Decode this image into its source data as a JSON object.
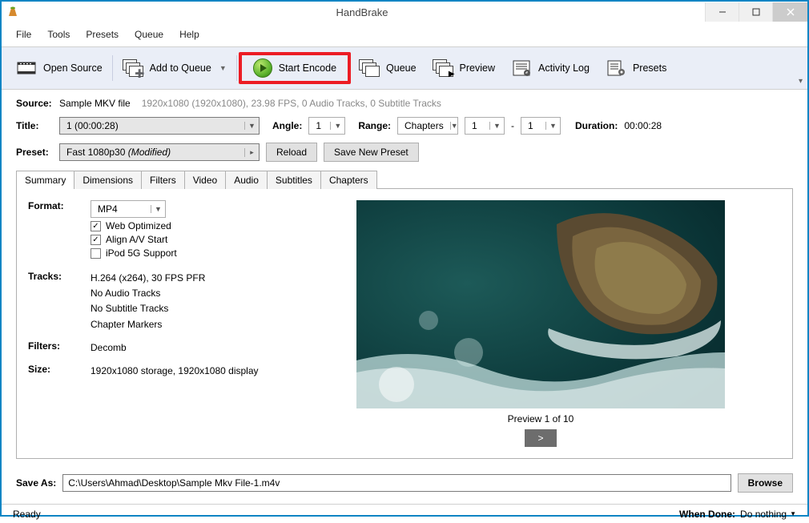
{
  "title": "HandBrake",
  "menubar": [
    "File",
    "Tools",
    "Presets",
    "Queue",
    "Help"
  ],
  "toolbar": {
    "open_source": "Open Source",
    "add_to_queue": "Add to Queue",
    "start_encode": "Start Encode",
    "queue": "Queue",
    "preview": "Preview",
    "activity_log": "Activity Log",
    "presets": "Presets"
  },
  "source": {
    "label": "Source:",
    "name": "Sample MKV file",
    "info": "1920x1080 (1920x1080), 23.98 FPS, 0 Audio Tracks, 0 Subtitle Tracks"
  },
  "title_row": {
    "label": "Title:",
    "value": "1 (00:00:28)",
    "angle_label": "Angle:",
    "angle_value": "1",
    "range_label": "Range:",
    "range_type": "Chapters",
    "range_from": "1",
    "range_dash": "-",
    "range_to": "1",
    "duration_label": "Duration:",
    "duration_value": "00:00:28"
  },
  "preset_row": {
    "label": "Preset:",
    "value": "Fast 1080p30",
    "modified": "(Modified)",
    "reload": "Reload",
    "save_new": "Save New Preset"
  },
  "tabs": [
    "Summary",
    "Dimensions",
    "Filters",
    "Video",
    "Audio",
    "Subtitles",
    "Chapters"
  ],
  "summary": {
    "format_label": "Format:",
    "format_value": "MP4",
    "chk_web": "Web Optimized",
    "chk_av": "Align A/V Start",
    "chk_ipod": "iPod 5G Support",
    "tracks_label": "Tracks:",
    "tracks": [
      "H.264 (x264), 30 FPS PFR",
      "No Audio Tracks",
      "No Subtitle Tracks",
      "Chapter Markers"
    ],
    "filters_label": "Filters:",
    "filters_value": "Decomb",
    "size_label": "Size:",
    "size_value": "1920x1080 storage, 1920x1080 display",
    "preview_label": "Preview 1 of 10",
    "preview_next": ">"
  },
  "saveas": {
    "label": "Save As:",
    "path": "C:\\Users\\Ahmad\\Desktop\\Sample Mkv File-1.m4v",
    "browse": "Browse"
  },
  "status": {
    "text": "Ready",
    "when_done_label": "When Done:",
    "when_done_value": "Do nothing"
  }
}
